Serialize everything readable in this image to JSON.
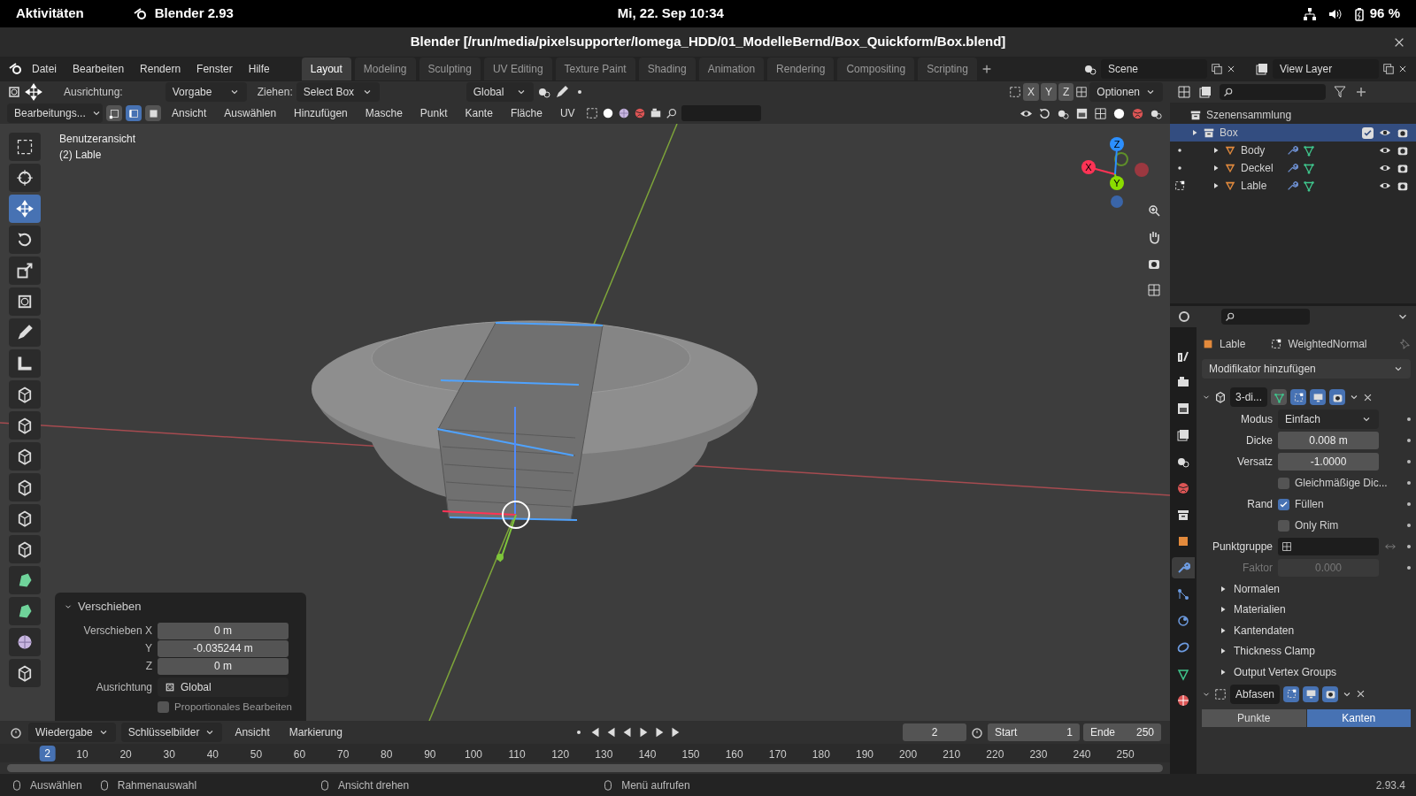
{
  "system_bar": {
    "activities": "Aktivitäten",
    "app": "Blender 2.93",
    "clock": "Mi, 22. Sep 10:34",
    "battery": "96 %"
  },
  "window": {
    "title": "Blender [/run/media/pixelsupporter/Iomega_HDD/01_ModelleBernd/Box_Quickform/Box.blend]"
  },
  "menus": [
    "Datei",
    "Bearbeiten",
    "Rendern",
    "Fenster",
    "Hilfe"
  ],
  "workspaces": [
    {
      "label": "Layout",
      "selected": true
    },
    {
      "label": "Modeling",
      "selected": false
    },
    {
      "label": "Sculpting",
      "selected": false
    },
    {
      "label": "UV Editing",
      "selected": false
    },
    {
      "label": "Texture Paint",
      "selected": false
    },
    {
      "label": "Shading",
      "selected": false
    },
    {
      "label": "Animation",
      "selected": false
    },
    {
      "label": "Rendering",
      "selected": false
    },
    {
      "label": "Compositing",
      "selected": false
    },
    {
      "label": "Scripting",
      "selected": false
    }
  ],
  "scene": "Scene",
  "view_layer": "View Layer",
  "tool_settings": {
    "orientation_label": "Ausrichtung:",
    "orientation": "Vorgabe",
    "drag_label": "Ziehen:",
    "drag": "Select Box",
    "transform": "Global",
    "axes": [
      "X",
      "Y",
      "Z"
    ],
    "options": "Optionen"
  },
  "viewport_header": {
    "mode": "Bearbeitungs...",
    "select_modes": [
      {
        "kind": "vertex",
        "selected": false
      },
      {
        "kind": "edge",
        "selected": true
      },
      {
        "kind": "face",
        "selected": false
      }
    ],
    "menus": [
      "Ansicht",
      "Auswählen",
      "Hinzufügen",
      "Masche",
      "Punkt",
      "Kante",
      "Fläche",
      "UV"
    ]
  },
  "viewport": {
    "view_name": "Benutzeransicht",
    "object": "(2) Lable",
    "gizmo_axes": [
      "X",
      "Y",
      "Z"
    ]
  },
  "tools": [
    {
      "kind": "select",
      "selected": false
    },
    {
      "kind": "cursor",
      "selected": false
    },
    {
      "kind": "move",
      "selected": true
    },
    {
      "kind": "rotate",
      "selected": false
    },
    {
      "kind": "scale",
      "selected": false
    },
    {
      "kind": "transform",
      "selected": false
    },
    {
      "kind": "pen",
      "selected": false
    },
    {
      "kind": "ruler",
      "selected": false
    },
    {
      "kind": "cube",
      "selected": false
    },
    {
      "kind": "cube",
      "selected": false
    },
    {
      "kind": "cube",
      "selected": false
    },
    {
      "kind": "cube",
      "selected": false
    },
    {
      "kind": "cube",
      "selected": false
    },
    {
      "kind": "cube",
      "selected": false
    },
    {
      "kind": "mesh",
      "selected": false
    },
    {
      "kind": "mesh",
      "selected": false
    },
    {
      "kind": "sphere",
      "selected": false
    },
    {
      "kind": "cube",
      "selected": false
    }
  ],
  "operator_panel": {
    "title": "Verschieben",
    "fields": [
      {
        "label": "Verschieben X",
        "value": "0 m"
      },
      {
        "label": "Y",
        "value": "-0.035244 m"
      },
      {
        "label": "Z",
        "value": "0 m"
      }
    ],
    "orientation_label": "Ausrichtung",
    "orientation": "Global",
    "proportional": {
      "label": "Proportionales Bearbeiten",
      "checked": false
    }
  },
  "outliner": {
    "root": "Szenensammlung",
    "items": [
      {
        "label": "Box",
        "selected": true,
        "checked": true,
        "children": [
          {
            "label": "Body",
            "edit_mode": false
          },
          {
            "label": "Deckel",
            "edit_mode": false
          },
          {
            "label": "Lable",
            "edit_mode": true
          }
        ]
      }
    ]
  },
  "properties": {
    "tabs": [
      {
        "kind": "tool",
        "selected": false
      },
      {
        "kind": "render",
        "selected": false
      },
      {
        "kind": "output",
        "selected": false
      },
      {
        "kind": "view-layer",
        "selected": false
      },
      {
        "kind": "scene",
        "selected": false
      },
      {
        "kind": "world",
        "selected": false
      },
      {
        "kind": "collection",
        "selected": false
      },
      {
        "kind": "object",
        "selected": false
      },
      {
        "kind": "modifier",
        "selected": true
      },
      {
        "kind": "particles",
        "selected": false
      },
      {
        "kind": "physics",
        "selected": false
      },
      {
        "kind": "constraints",
        "selected": false
      },
      {
        "kind": "data",
        "selected": false
      },
      {
        "kind": "material",
        "selected": false
      }
    ],
    "object": "Lable",
    "modifier": "WeightedNormal",
    "add_modifier": "Modifikator hinzufügen",
    "solidify": {
      "name": "3-di...",
      "expanded": true,
      "rows": [
        {
          "kind": "select",
          "label": "Modus",
          "value": "Einfach"
        },
        {
          "kind": "number",
          "label": "Dicke",
          "value": "0.008 m"
        },
        {
          "kind": "number",
          "label": "Versatz",
          "value": "-1.0000"
        },
        {
          "kind": "checkbox",
          "text": "Gleichmäßige Dic...",
          "checked": false
        },
        {
          "kind": "checkbox",
          "label": "Rand",
          "text": "Füllen",
          "checked": true
        },
        {
          "kind": "checkbox",
          "text": "Only Rim",
          "checked": false
        },
        {
          "kind": "group",
          "label": "Punktgruppe"
        },
        {
          "kind": "number",
          "label": "Faktor",
          "value": "0.000",
          "disabled": true
        }
      ],
      "subpanels": [
        "Normalen",
        "Materialien",
        "Kantendaten",
        "Thickness Clamp",
        "Output Vertex Groups"
      ]
    },
    "bevel": {
      "name": "Abfasen",
      "expanded": true,
      "segments": [
        {
          "label": "Punkte",
          "selected": false
        },
        {
          "label": "Kanten",
          "selected": true
        }
      ]
    }
  },
  "timeline": {
    "menus": [
      "Wiedergabe",
      "Schlüsselbilder",
      "Ansicht",
      "Markierung"
    ],
    "frame": "2",
    "start_label": "Start",
    "start": "1",
    "end_label": "Ende",
    "end": "250",
    "current": "2",
    "ticks": [
      "10",
      "20",
      "30",
      "40",
      "50",
      "60",
      "70",
      "80",
      "90",
      "100",
      "110",
      "120",
      "130",
      "140",
      "150",
      "160",
      "170",
      "180",
      "190",
      "200",
      "210",
      "220",
      "230",
      "240",
      "250"
    ]
  },
  "status_bar": {
    "hints": [
      "Auswählen",
      "Rahmenauswahl",
      "Ansicht drehen",
      "Menü aufrufen"
    ],
    "version": "2.93.4"
  }
}
